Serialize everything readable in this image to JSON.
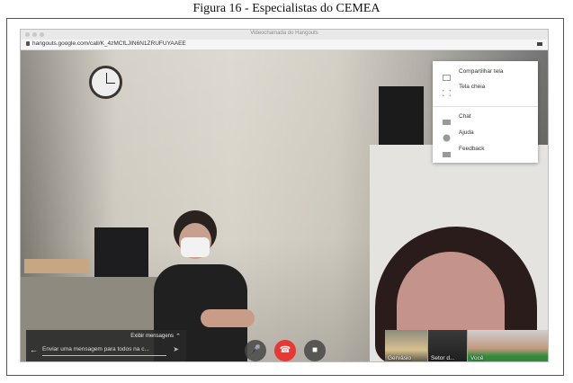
{
  "caption": "Figura 16 - Especialistas do CEMEA",
  "window": {
    "title": "Videochamada do Hangouts"
  },
  "browser": {
    "url": "hangouts.google.com/call/K_4zMCfLJIN6N1ZRUFUYAAEE"
  },
  "menu": {
    "items": [
      {
        "label": "Compartilhar tela",
        "icon": "screen-share-icon"
      },
      {
        "label": "Tela cheia",
        "icon": "fullscreen-icon"
      },
      {
        "label": "Chat",
        "icon": "chat-icon"
      },
      {
        "label": "Ajuda",
        "icon": "help-icon"
      },
      {
        "label": "Feedback",
        "icon": "feedback-icon"
      }
    ]
  },
  "chat": {
    "toggle_label": "Exibir mensagens",
    "placeholder": "Enviar uma mensagem para todos na c..."
  },
  "controls": {
    "mic": "mic-icon",
    "hangup": "hangup-icon",
    "camera": "camera-icon",
    "hangup_color": "#e53935"
  },
  "participants": [
    {
      "name": "Gervásio"
    },
    {
      "name": "Setor d..."
    },
    {
      "name": "Você"
    }
  ]
}
